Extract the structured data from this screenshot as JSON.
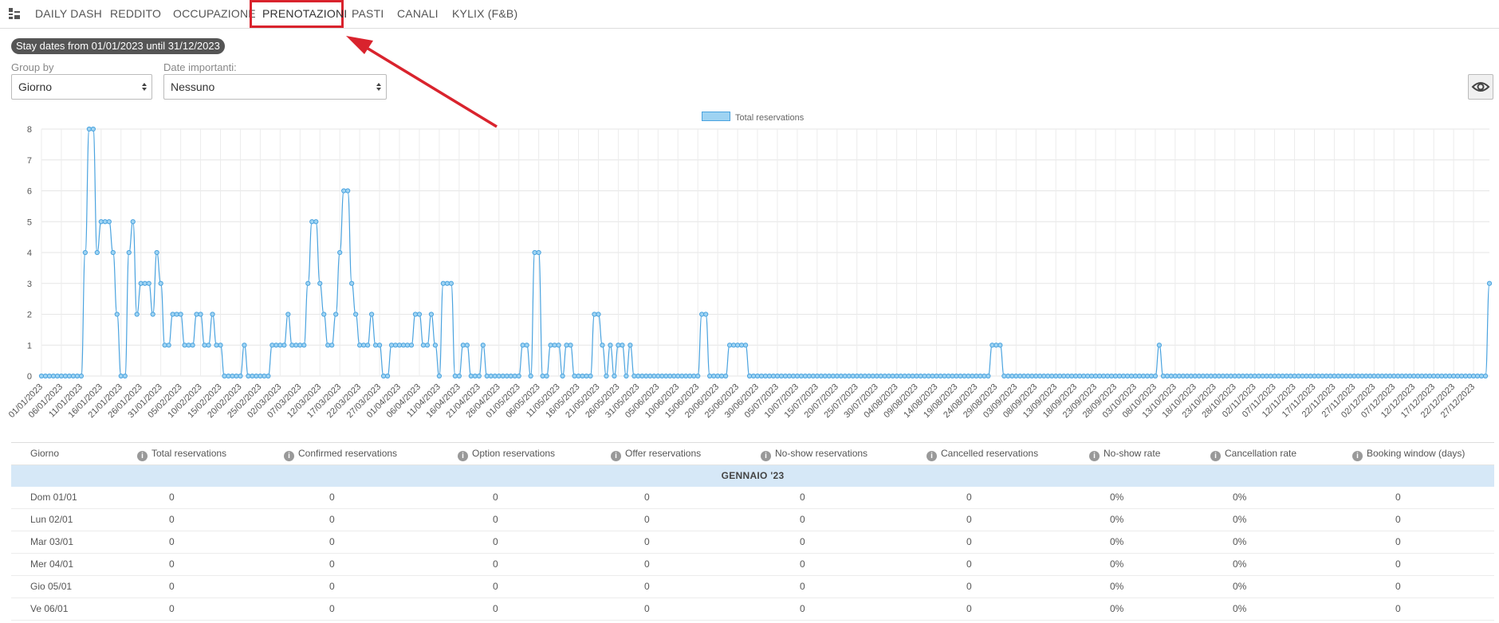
{
  "nav": {
    "tabs": [
      {
        "label": "DAILY DASH"
      },
      {
        "label": "REDDITO"
      },
      {
        "label": "OCCUPAZIONE"
      },
      {
        "label": "PRENOTAZIONI"
      },
      {
        "label": "PASTI"
      },
      {
        "label": "CANALI"
      },
      {
        "label": "KYLIX (F&B)"
      }
    ],
    "active_tab": "PRENOTAZIONI"
  },
  "filters": {
    "stay_dates": "Stay dates from 01/01/2023 until 31/12/2023",
    "group_by_label": "Group by",
    "group_by_value": "Giorno",
    "important_dates_label": "Date importanti:",
    "important_dates_value": "Nessuno"
  },
  "colors": {
    "accent_red": "#d9232d",
    "series_line": "#4aa3df",
    "series_fill": "#9ed3f2",
    "month_band": "#d6e8f7"
  },
  "chart_data": {
    "type": "line",
    "title": "",
    "series": [
      {
        "name": "Total reservations"
      }
    ],
    "ylim": [
      0,
      8
    ],
    "yticks": [
      0,
      1,
      2,
      3,
      4,
      5,
      6,
      7,
      8
    ],
    "x_tick_labels": [
      "01/01/2023",
      "06/01/2023",
      "11/01/2023",
      "16/01/2023",
      "21/01/2023",
      "26/01/2023",
      "31/01/2023",
      "05/02/2023",
      "10/02/2023",
      "15/02/2023",
      "20/02/2023",
      "25/02/2023",
      "02/03/2023",
      "07/03/2023",
      "12/03/2023",
      "17/03/2023",
      "22/03/2023",
      "27/03/2023",
      "01/04/2023",
      "06/04/2023",
      "11/04/2023",
      "16/04/2023",
      "21/04/2023",
      "26/04/2023",
      "01/05/2023",
      "06/05/2023",
      "11/05/2023",
      "16/05/2023",
      "21/05/2023",
      "26/05/2023",
      "31/05/2023",
      "05/06/2023",
      "10/06/2023",
      "15/06/2023",
      "20/06/2023",
      "25/06/2023",
      "30/06/2023",
      "05/07/2023",
      "10/07/2023",
      "15/07/2023",
      "20/07/2023",
      "25/07/2023",
      "30/07/2023",
      "04/08/2023",
      "09/08/2023",
      "14/08/2023",
      "19/08/2023",
      "24/08/2023",
      "29/08/2023",
      "03/09/2023",
      "08/09/2023",
      "13/09/2023",
      "18/09/2023",
      "23/09/2023",
      "28/09/2023",
      "03/10/2023",
      "08/10/2023",
      "13/10/2023",
      "18/10/2023",
      "23/10/2023",
      "28/10/2023",
      "02/11/2023",
      "07/11/2023",
      "12/11/2023",
      "17/11/2023",
      "22/11/2023",
      "27/11/2023",
      "02/12/2023",
      "07/12/2023",
      "12/12/2023",
      "17/12/2023",
      "22/12/2023",
      "27/12/2023"
    ],
    "x_start": "01/01/2023",
    "x_end": "31/12/2023",
    "spikes": [
      {
        "day": 12,
        "value": 4
      },
      {
        "day": 13,
        "value": 8
      },
      {
        "day": 14,
        "value": 8
      },
      {
        "day": 15,
        "value": 4
      },
      {
        "day": 16,
        "value": 5
      },
      {
        "day": 17,
        "value": 5
      },
      {
        "day": 18,
        "value": 5
      },
      {
        "day": 19,
        "value": 4
      },
      {
        "day": 20,
        "value": 2
      },
      {
        "day": 23,
        "value": 4
      },
      {
        "day": 24,
        "value": 5
      },
      {
        "day": 25,
        "value": 2
      },
      {
        "day": 26,
        "value": 3
      },
      {
        "day": 27,
        "value": 3
      },
      {
        "day": 28,
        "value": 3
      },
      {
        "day": 29,
        "value": 2
      },
      {
        "day": 30,
        "value": 4
      },
      {
        "day": 31,
        "value": 3
      },
      {
        "day": 32,
        "value": 1
      },
      {
        "day": 33,
        "value": 1
      },
      {
        "day": 34,
        "value": 2
      },
      {
        "day": 35,
        "value": 2
      },
      {
        "day": 36,
        "value": 2
      },
      {
        "day": 37,
        "value": 1
      },
      {
        "day": 38,
        "value": 1
      },
      {
        "day": 39,
        "value": 1
      },
      {
        "day": 40,
        "value": 2
      },
      {
        "day": 41,
        "value": 2
      },
      {
        "day": 42,
        "value": 1
      },
      {
        "day": 43,
        "value": 1
      },
      {
        "day": 44,
        "value": 2
      },
      {
        "day": 45,
        "value": 1
      },
      {
        "day": 46,
        "value": 1
      },
      {
        "day": 52,
        "value": 1
      },
      {
        "day": 59,
        "value": 1
      },
      {
        "day": 60,
        "value": 1
      },
      {
        "day": 61,
        "value": 1
      },
      {
        "day": 62,
        "value": 1
      },
      {
        "day": 63,
        "value": 2
      },
      {
        "day": 64,
        "value": 1
      },
      {
        "day": 65,
        "value": 1
      },
      {
        "day": 66,
        "value": 1
      },
      {
        "day": 67,
        "value": 1
      },
      {
        "day": 68,
        "value": 3
      },
      {
        "day": 69,
        "value": 5
      },
      {
        "day": 70,
        "value": 5
      },
      {
        "day": 71,
        "value": 3
      },
      {
        "day": 72,
        "value": 2
      },
      {
        "day": 73,
        "value": 1
      },
      {
        "day": 74,
        "value": 1
      },
      {
        "day": 75,
        "value": 2
      },
      {
        "day": 76,
        "value": 4
      },
      {
        "day": 77,
        "value": 6
      },
      {
        "day": 78,
        "value": 6
      },
      {
        "day": 79,
        "value": 3
      },
      {
        "day": 80,
        "value": 2
      },
      {
        "day": 81,
        "value": 1
      },
      {
        "day": 82,
        "value": 1
      },
      {
        "day": 83,
        "value": 1
      },
      {
        "day": 84,
        "value": 2
      },
      {
        "day": 85,
        "value": 1
      },
      {
        "day": 86,
        "value": 1
      },
      {
        "day": 89,
        "value": 1
      },
      {
        "day": 90,
        "value": 1
      },
      {
        "day": 91,
        "value": 1
      },
      {
        "day": 92,
        "value": 1
      },
      {
        "day": 93,
        "value": 1
      },
      {
        "day": 94,
        "value": 1
      },
      {
        "day": 95,
        "value": 2
      },
      {
        "day": 96,
        "value": 2
      },
      {
        "day": 97,
        "value": 1
      },
      {
        "day": 98,
        "value": 1
      },
      {
        "day": 99,
        "value": 2
      },
      {
        "day": 100,
        "value": 1
      },
      {
        "day": 102,
        "value": 3
      },
      {
        "day": 103,
        "value": 3
      },
      {
        "day": 104,
        "value": 3
      },
      {
        "day": 107,
        "value": 1
      },
      {
        "day": 108,
        "value": 1
      },
      {
        "day": 112,
        "value": 1
      },
      {
        "day": 122,
        "value": 1
      },
      {
        "day": 123,
        "value": 1
      },
      {
        "day": 125,
        "value": 4
      },
      {
        "day": 126,
        "value": 4
      },
      {
        "day": 129,
        "value": 1
      },
      {
        "day": 130,
        "value": 1
      },
      {
        "day": 131,
        "value": 1
      },
      {
        "day": 133,
        "value": 1
      },
      {
        "day": 134,
        "value": 1
      },
      {
        "day": 140,
        "value": 2
      },
      {
        "day": 141,
        "value": 2
      },
      {
        "day": 142,
        "value": 1
      },
      {
        "day": 144,
        "value": 1
      },
      {
        "day": 146,
        "value": 1
      },
      {
        "day": 147,
        "value": 1
      },
      {
        "day": 149,
        "value": 1
      },
      {
        "day": 167,
        "value": 2
      },
      {
        "day": 168,
        "value": 2
      },
      {
        "day": 174,
        "value": 1
      },
      {
        "day": 175,
        "value": 1
      },
      {
        "day": 176,
        "value": 1
      },
      {
        "day": 177,
        "value": 1
      },
      {
        "day": 178,
        "value": 1
      },
      {
        "day": 240,
        "value": 1
      },
      {
        "day": 241,
        "value": 1
      },
      {
        "day": 242,
        "value": 1
      },
      {
        "day": 282,
        "value": 1
      },
      {
        "day": 365,
        "value": 3
      }
    ],
    "grid": true,
    "legend": "top-center"
  },
  "table": {
    "columns": [
      {
        "label": "Giorno",
        "info": false
      },
      {
        "label": "Total reservations",
        "info": true
      },
      {
        "label": "Confirmed reservations",
        "info": true
      },
      {
        "label": "Option reservations",
        "info": true
      },
      {
        "label": "Offer reservations",
        "info": true
      },
      {
        "label": "No-show reservations",
        "info": true
      },
      {
        "label": "Cancelled reservations",
        "info": true
      },
      {
        "label": "No-show rate",
        "info": true
      },
      {
        "label": "Cancellation rate",
        "info": true
      },
      {
        "label": "Booking window (days)",
        "info": true
      }
    ],
    "month": "GENNAIO '23",
    "rows": [
      [
        "Dom 01/01",
        "0",
        "0",
        "0",
        "0",
        "0",
        "0",
        "0%",
        "0%",
        "0"
      ],
      [
        "Lun 02/01",
        "0",
        "0",
        "0",
        "0",
        "0",
        "0",
        "0%",
        "0%",
        "0"
      ],
      [
        "Mar 03/01",
        "0",
        "0",
        "0",
        "0",
        "0",
        "0",
        "0%",
        "0%",
        "0"
      ],
      [
        "Mer 04/01",
        "0",
        "0",
        "0",
        "0",
        "0",
        "0",
        "0%",
        "0%",
        "0"
      ],
      [
        "Gio 05/01",
        "0",
        "0",
        "0",
        "0",
        "0",
        "0",
        "0%",
        "0%",
        "0"
      ],
      [
        "Ve 06/01",
        "0",
        "0",
        "0",
        "0",
        "0",
        "0",
        "0%",
        "0%",
        "0"
      ]
    ]
  }
}
